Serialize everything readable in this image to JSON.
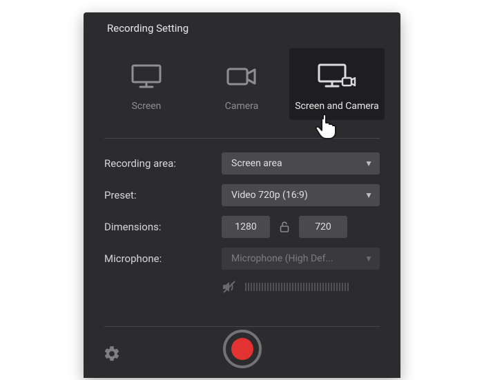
{
  "title": "Recording Setting",
  "modes": {
    "screen": "Screen",
    "camera": "Camera",
    "screen_camera": "Screen and Camera"
  },
  "labels": {
    "recording_area": "Recording area:",
    "preset": "Preset:",
    "dimensions": "Dimensions:",
    "microphone": "Microphone:"
  },
  "values": {
    "recording_area": "Screen area",
    "preset": "Video 720p (16:9)",
    "width": "1280",
    "height": "720",
    "microphone": "Microphone (High Def..."
  }
}
